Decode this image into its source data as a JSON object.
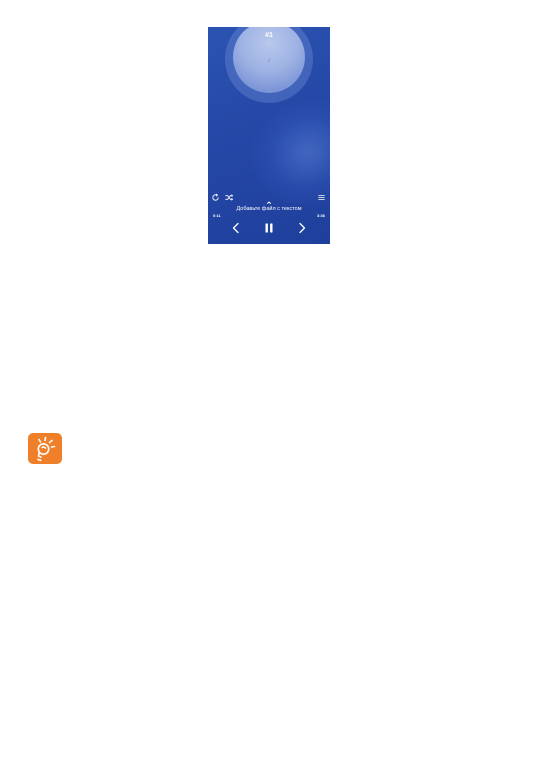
{
  "player": {
    "track_number": "#1",
    "lyrics_hint": "Добавьте файл с текстом",
    "time_caption": "",
    "time_elapsed": "0:11",
    "time_total": "3:36"
  },
  "icons": {
    "repeat": "repeat-icon",
    "shuffle": "shuffle-icon",
    "playlist": "playlist-icon",
    "previous": "previous-icon",
    "pause": "pause-icon",
    "next": "next-icon",
    "expand": "chevron-up-icon",
    "tip": "lightbulb-icon",
    "album_art": "music-note-icon"
  },
  "colors": {
    "screen_background": "#2547a6",
    "tip_background": "#f07f2a",
    "foreground": "#ffffff"
  }
}
